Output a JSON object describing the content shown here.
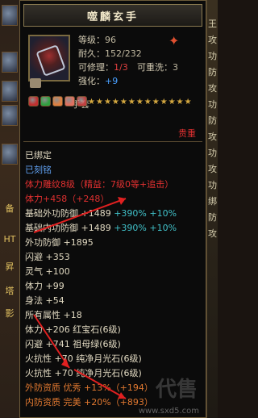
{
  "left_strip": {
    "labels": [
      "HT",
      "昇",
      "塔",
      "影",
      "备"
    ]
  },
  "right_strip": {
    "chars": [
      "王",
      "攻",
      "功",
      "防",
      "攻",
      "功",
      "防",
      "攻",
      "功",
      "攻",
      "功",
      "绑",
      "防",
      "攻"
    ]
  },
  "tooltip": {
    "title": "噬麟玄手",
    "level_label": "等级：",
    "level_value": "96",
    "durability_label": "耐久：",
    "durability_value": "152/232",
    "repair_label": "可修理：",
    "repair_value": "1/3",
    "rewash_label": "可重洗：",
    "rewash_value": "3",
    "strength_label": "强化：",
    "strength_value": "+9",
    "category": "手套",
    "stars": 13,
    "quality": "贵重",
    "gems": [
      "#c03030",
      "#30a040",
      "#e08040",
      "#e07060",
      "#c04040"
    ]
  },
  "attributes": [
    {
      "text": "已绑定",
      "color": "white"
    },
    {
      "text": "已刻铭",
      "color": "blue"
    },
    {
      "text": "体力雕纹8级（精益：7级0等+追击）",
      "color": "red"
    },
    {
      "text": "体力+458（+248）",
      "color": "red"
    },
    {
      "text": "基础外功防御 +1489 +390% +10%",
      "color": "white_cyan"
    },
    {
      "text": "基础内功防御 +1489 +390% +10%",
      "color": "white_cyan"
    },
    {
      "text": "外功防御 +1895",
      "color": "white"
    },
    {
      "text": "闪避 +353",
      "color": "white"
    },
    {
      "text": "灵气 +100",
      "color": "white"
    },
    {
      "text": "体力 +99",
      "color": "white"
    },
    {
      "text": "身法 +54",
      "color": "white"
    },
    {
      "text": "所有属性 +18",
      "color": "white"
    },
    {
      "text": "体力 +206 红宝石(6级)",
      "color": "white"
    },
    {
      "text": "闪避 +741 祖母绿(6级)",
      "color": "white"
    },
    {
      "text": "火抗性 +70 纯净月光石(6级)",
      "color": "white"
    },
    {
      "text": "火抗性 +70 纯净月光石(6级)",
      "color": "white"
    },
    {
      "text": "外防资质 优秀 +13%（+194）",
      "color": "orange"
    },
    {
      "text": "内防资质 完美 +20%（+893）",
      "color": "orange"
    }
  ],
  "watermark": {
    "site": "www.sxd5.com",
    "logo": "代售"
  }
}
